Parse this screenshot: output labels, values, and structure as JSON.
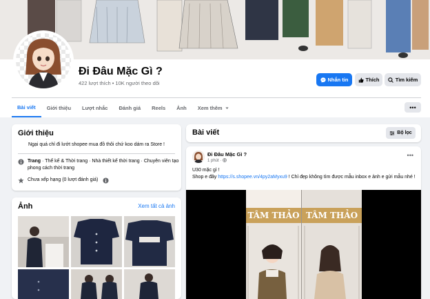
{
  "page": {
    "name": "Đi Đâu Mặc Gì ?",
    "stats": "422 lượt thích • 10K người theo dõi"
  },
  "actions": {
    "message": "Nhắn tin",
    "like": "Thích",
    "search": "Tìm kiếm"
  },
  "tabs": [
    {
      "label": "Bài viết"
    },
    {
      "label": "Giới thiệu"
    },
    {
      "label": "Lượt nhắc"
    },
    {
      "label": "Đánh giá"
    },
    {
      "label": "Reels"
    },
    {
      "label": "Ảnh"
    },
    {
      "label": "Xem thêm"
    }
  ],
  "more_label": "•••",
  "intro": {
    "title": "Giới thiệu",
    "bio": "Ngại quá chỉ đi lướt shopee mua đồ thôi chứ koo dám ra Store !",
    "category_bold": "Trang",
    "category_rest": " · Thể kế & Thời trang · Nhà thiết kế thời trang · Chuyên viên tạo phong cách thời trang",
    "rating": "Chưa xếp hạng (0 lượt đánh giá)"
  },
  "photos": {
    "title": "Ảnh",
    "see_all": "Xem tất cả ảnh"
  },
  "posts": {
    "title": "Bài viết",
    "filter": "Bộ lọc"
  },
  "post": {
    "author": "Đi Đâu Mặc Gì ?",
    "time": "1 phút ·",
    "line1": "U30 mặc gì !",
    "line2_prefix": "Shop e đây ",
    "link": "https://s.shopee.vn/4py2aMyxu9",
    "line2_suffix": " ! Chỉ đẹp không tìm được mẫu inbox e ảnh e gửi mẫu nhé !",
    "sign_left": "TÂM THẢO",
    "sign_right": "TÂM THẢO"
  },
  "colors": {
    "accent": "#1877f2",
    "bg": "#f0f2f5",
    "muted": "#65676b"
  },
  "icons": {
    "messenger": "messenger-icon",
    "like": "thumbs-up-icon",
    "search": "search-icon",
    "info": "info-icon",
    "star": "star-icon",
    "filter": "filter-icon"
  }
}
